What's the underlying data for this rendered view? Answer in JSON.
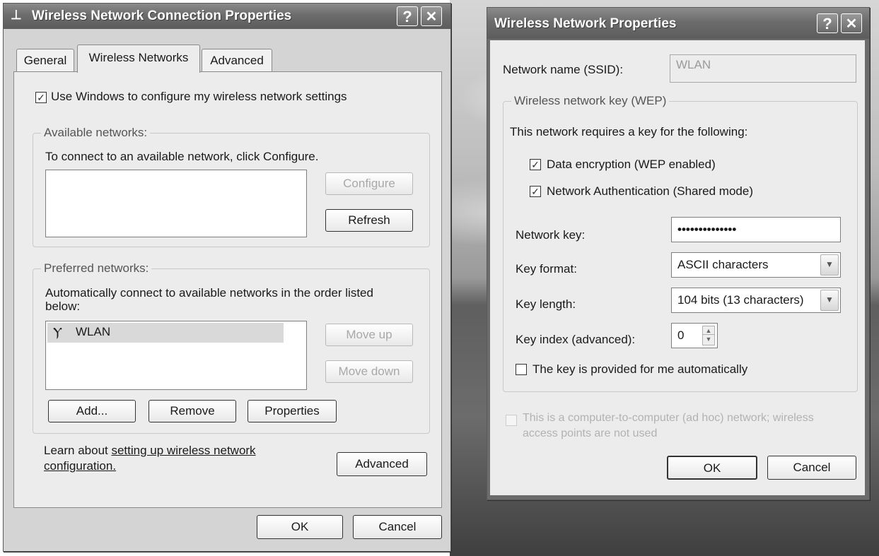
{
  "left_window": {
    "title": "Wireless Network Connection Properties",
    "help_button": "?",
    "close_button": "✕",
    "tabs": [
      {
        "label": "General",
        "active": false
      },
      {
        "label": "Wireless Networks",
        "active": true
      },
      {
        "label": "Advanced",
        "active": false
      }
    ],
    "use_windows_checkbox": {
      "label": "Use Windows to configure my wireless network settings",
      "checked": true
    },
    "available_networks": {
      "group_label": "Available networks:",
      "description": "To connect to an available network, click Configure.",
      "configure_button": "Configure",
      "refresh_button": "Refresh"
    },
    "preferred_networks": {
      "group_label": "Preferred networks:",
      "description_line1": "Automatically connect to available networks in the order listed",
      "description_line2": "below:",
      "items": [
        {
          "name": "WLAN"
        }
      ],
      "move_up_button": "Move up",
      "move_down_button": "Move down",
      "add_button": "Add...",
      "remove_button": "Remove",
      "properties_button": "Properties"
    },
    "learn_text": "Learn about ",
    "learn_link_line1": "setting up wireless network",
    "learn_link_line2": "configuration.",
    "advanced_button": "Advanced",
    "ok_button": "OK",
    "cancel_button": "Cancel"
  },
  "right_window": {
    "title": "Wireless Network Properties",
    "help_button": "?",
    "close_button": "✕",
    "ssid_label": "Network name (SSID):",
    "ssid_value": "WLAN",
    "wep_group_label": "Wireless network key (WEP)",
    "requires_text": "This network requires a key for the following:",
    "data_encryption": {
      "label": "Data encryption (WEP enabled)",
      "checked": true
    },
    "network_auth": {
      "label": "Network Authentication (Shared mode)",
      "checked": true
    },
    "network_key_label": "Network key:",
    "network_key_value": "••••••••••••••",
    "key_format_label": "Key format:",
    "key_format_value": "ASCII characters",
    "key_length_label": "Key length:",
    "key_length_value": "104 bits (13 characters)",
    "key_index_label": "Key index (advanced):",
    "key_index_value": "0",
    "auto_key": {
      "label": "The key is provided for me automatically",
      "checked": false
    },
    "adhoc": {
      "label_line1": "This is a computer-to-computer (ad hoc) network; wireless",
      "label_line2": "access points are not used",
      "checked": false
    },
    "ok_button": "OK",
    "cancel_button": "Cancel"
  },
  "colors": {
    "titlebar": "#6c6c6c",
    "dialog_bg": "#ececec",
    "frame": "#d4d4d4"
  }
}
